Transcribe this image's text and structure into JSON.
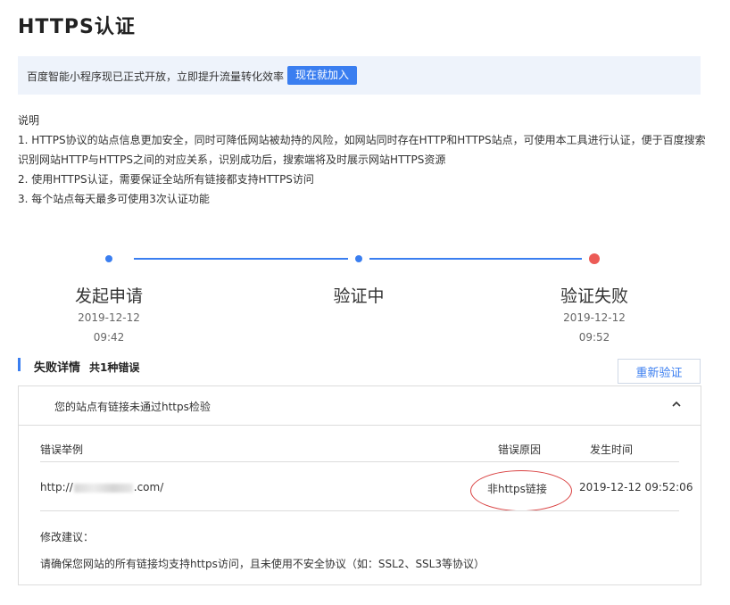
{
  "page": {
    "title": "HTTPS认证"
  },
  "banner": {
    "text": "百度智能小程序现已正式开放，立即提升流量转化效率",
    "button": "现在就加入"
  },
  "description": {
    "heading": "说明",
    "items": [
      "1. HTTPS协议的站点信息更加安全，同时可降低网站被劫持的风险，如网站同时存在HTTP和HTTPS站点，可使用本工具进行认证，便于百度搜索",
      "识别网站HTTP与HTTPS之间的对应关系，识别成功后，搜索端将及时展示网站HTTPS资源",
      "2. 使用HTTPS认证，需要保证全站所有链接都支持HTTPS访问",
      "3. 每个站点每天最多可使用3次认证功能"
    ]
  },
  "steps": [
    {
      "label": "发起申请",
      "date": "2019-12-12",
      "time": "09:42",
      "color": "#3a7ef0"
    },
    {
      "label": "验证中",
      "date": "",
      "time": "",
      "color": "#3a7ef0"
    },
    {
      "label": "验证失败",
      "date": "2019-12-12",
      "time": "09:52",
      "color": "#ec5b56"
    }
  ],
  "failure": {
    "title": "失败详情",
    "count": "共1种错误",
    "reverify_button": "重新验证",
    "panel_title": "您的站点有链接未通过https检验",
    "columns": {
      "example": "错误举例",
      "reason": "错误原因",
      "time": "发生时间"
    },
    "row": {
      "url_prefix": "http://",
      "url_suffix": ".com/",
      "reason": "非https链接",
      "time": "2019-12-12 09:52:06"
    },
    "suggestion_title": "修改建议：",
    "suggestion_text": "请确保您网站的所有链接均支持https访问，且未使用不安全协议（如：SSL2、SSL3等协议）"
  },
  "icons": {
    "collapse": "chevron-up-icon"
  }
}
